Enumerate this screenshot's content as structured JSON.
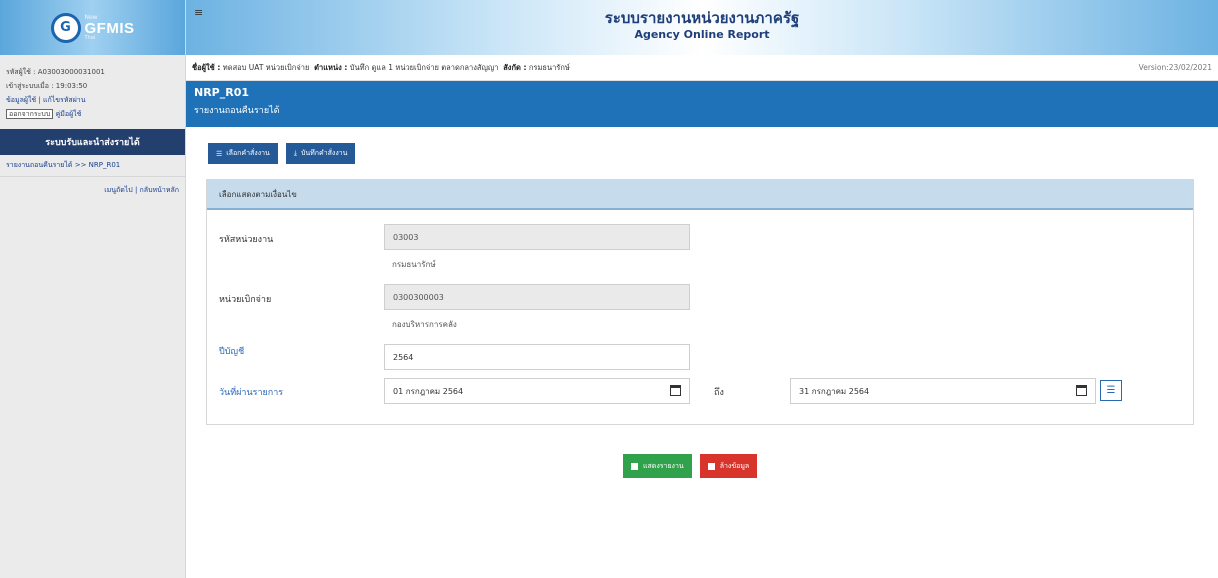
{
  "logo": {
    "new_label": "New",
    "name": "GFMIS",
    "sub": "Thai"
  },
  "user": {
    "user_id_line": "รหัสผู้ใช้ : A03003000031001",
    "login_time_line": "เข้าสู่ระบบเมื่อ : 19:03:50",
    "profile_link": "ข้อมูลผู้ใช้",
    "change_password_link": "แก้ไขรหัสผ่าน",
    "logout_button": "ออกจากระบบ",
    "user_manual_link": "คู่มือผู้ใช้"
  },
  "sidebar": {
    "menu_title": "ระบบรับและนำส่งรายได้",
    "items": [
      {
        "label": "รายงานถอนคืนรายได้ >> NRP_R01"
      }
    ],
    "links": "เมนูถัดไป | กลับหน้าหลัก"
  },
  "header": {
    "title": "ระบบรายงานหน่วยงานภาครัฐ",
    "subtitle": "Agency Online Report",
    "menu_icon": "≡"
  },
  "userbar": {
    "name_label": "ชื่อผู้ใช้ :",
    "name_value": "ทดสอบ UAT หน่วยเบิกจ่าย",
    "position_label": "ตำแหน่ง :",
    "position_value": "บันทึก ดูแล 1 หน่วยเบิกจ่าย ตลาดกลางสัญญา",
    "affiliation_label": "สังกัด :",
    "affiliation_value": "กรมธนารักษ์",
    "version": "Version:23/02/2021"
  },
  "pagebar": {
    "code": "NRP_R01",
    "name": "รายงานถอนคืนรายได้"
  },
  "toolbar": {
    "select_program_label": "เลือกคำสั่งงาน",
    "save_program_label": "บันทึกคำสั่งงาน"
  },
  "panel": {
    "title": "เลือกแสดงตามเงื่อนไข"
  },
  "form": {
    "agency_label": "รหัสหน่วยงาน",
    "agency_value": "03003",
    "agency_name": "กรมธนารักษ์",
    "disburse_label": "หน่วยเบิกจ่าย",
    "disburse_value": "0300300003",
    "disburse_name": "กองบริหารการคลัง",
    "fiscal_year_label": "ปีบัญชี",
    "fiscal_year_value": "2564",
    "date_label": "วันที่ผ่านรายการ",
    "date_from": "01 กรกฎาคม 2564",
    "to_label": "ถึง",
    "date_to": "31 กรกฎาคม 2564"
  },
  "actions": {
    "show_report_label": "แสดงรายงาน",
    "clear_label": "ล้างข้อมูล"
  },
  "colors": {
    "primary_blue": "#1f72b8",
    "dark_blue": "#233f6e",
    "button_blue": "#255a99",
    "green": "#31a24c",
    "red": "#d9342b"
  }
}
